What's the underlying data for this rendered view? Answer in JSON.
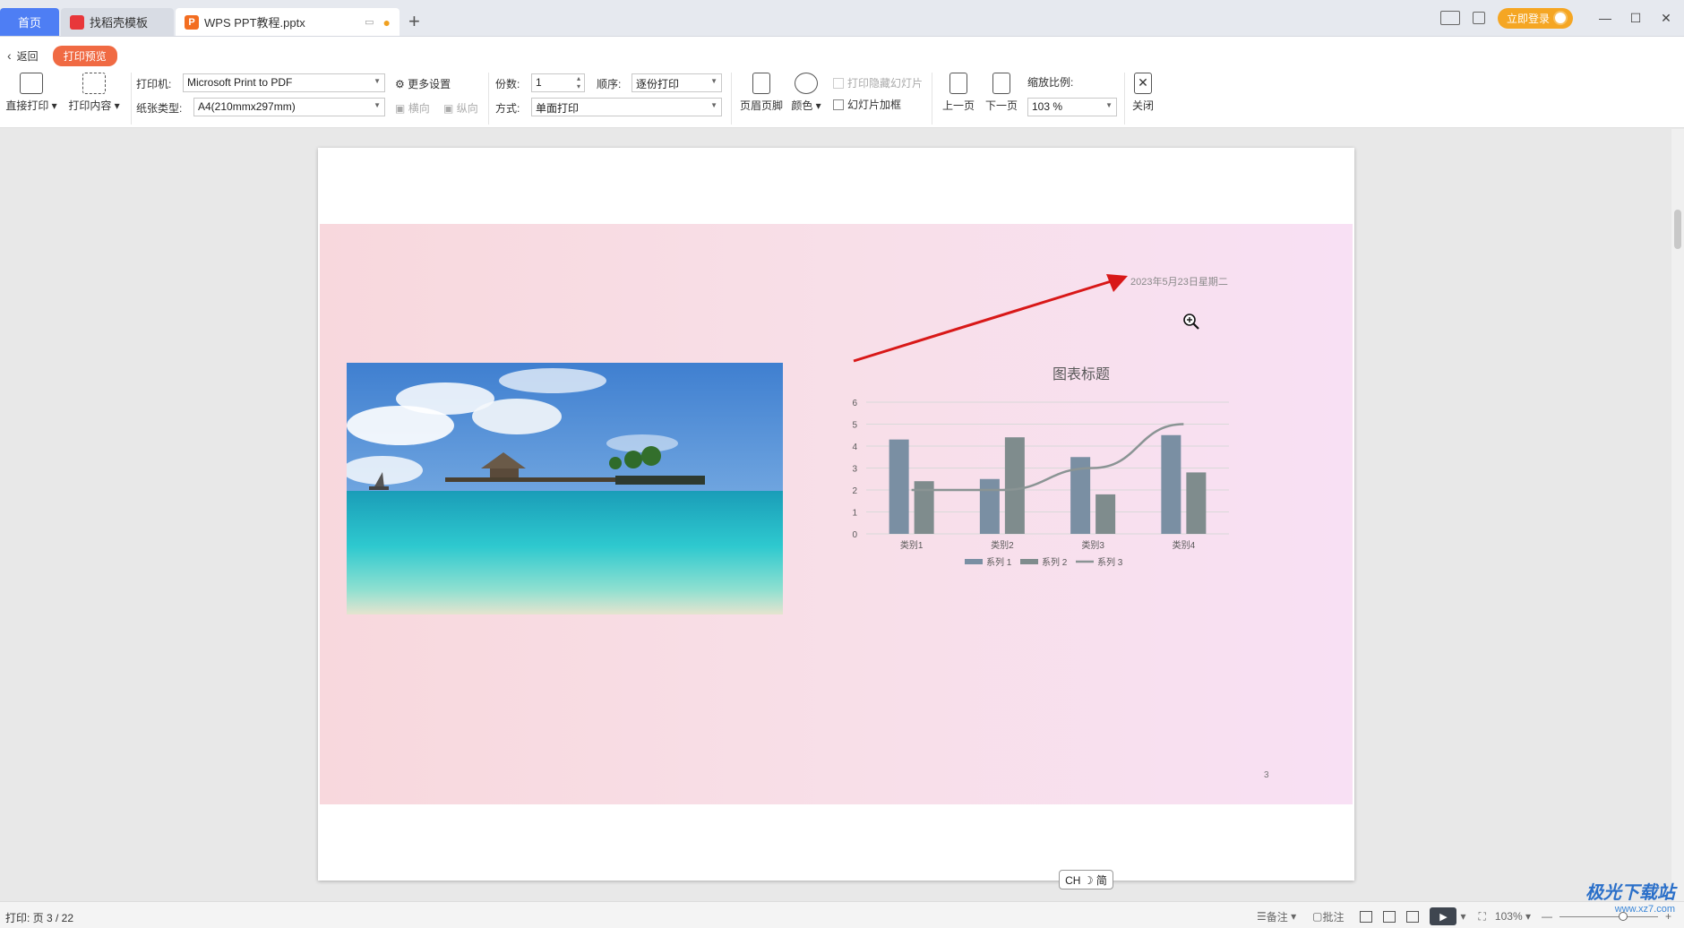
{
  "tabs": {
    "home": "首页",
    "template": "找稻壳模板",
    "document": "WPS PPT教程.pptx",
    "new_tab": "+"
  },
  "title_bar": {
    "login": "立即登录",
    "minimize": "—",
    "maximize": "☐",
    "close": "✕"
  },
  "toolbar": {
    "back": "返回",
    "mode_pill": "打印预览",
    "direct_print": "直接打印",
    "print_content": "打印内容",
    "printer_label": "打印机:",
    "printer_value": "Microsoft Print to PDF",
    "more_settings": "更多设置",
    "paper_label": "纸张类型:",
    "paper_value": "A4(210mmx297mm)",
    "landscape": "横向",
    "portrait": "纵向",
    "copies_label": "份数:",
    "copies_value": "1",
    "order_label": "顺序:",
    "order_value": "逐份打印",
    "method_label": "方式:",
    "method_value": "单面打印",
    "header_footer": "页眉页脚",
    "color": "颜色",
    "print_hidden_slides": "打印隐藏幻灯片",
    "slide_frame": "幻灯片加框",
    "prev_page": "上一页",
    "next_page": "下一页",
    "zoom_label": "缩放比例:",
    "zoom_value": "103 %",
    "close": "关闭"
  },
  "slide": {
    "date": "2023年5月23日星期二",
    "page_number": "3"
  },
  "chart_data": {
    "type": "bar",
    "title": "图表标题",
    "categories": [
      "类别1",
      "类别2",
      "类别3",
      "类别4"
    ],
    "series": [
      {
        "name": "系列 1",
        "type": "bar",
        "color": "#7a8fa3",
        "values": [
          4.3,
          2.5,
          3.5,
          4.5
        ]
      },
      {
        "name": "系列 2",
        "type": "bar",
        "color": "#7f8c8d",
        "values": [
          2.4,
          4.4,
          1.8,
          2.8
        ]
      },
      {
        "name": "系列 3",
        "type": "line",
        "color": "#8a9494",
        "values": [
          2,
          2,
          3,
          5
        ]
      }
    ],
    "yticks": [
      "0",
      "1",
      "2",
      "3",
      "4",
      "5",
      "6"
    ],
    "ylim": [
      0,
      6
    ],
    "grid": true,
    "legend": "bottom"
  },
  "ime": "CH ☽ 简",
  "status": {
    "print_info": "打印: 页 3 / 22",
    "notes": "备注",
    "comments": "批注",
    "zoom": "103%"
  },
  "watermark": {
    "brand": "极光下载站",
    "url": "www.xz7.com"
  }
}
